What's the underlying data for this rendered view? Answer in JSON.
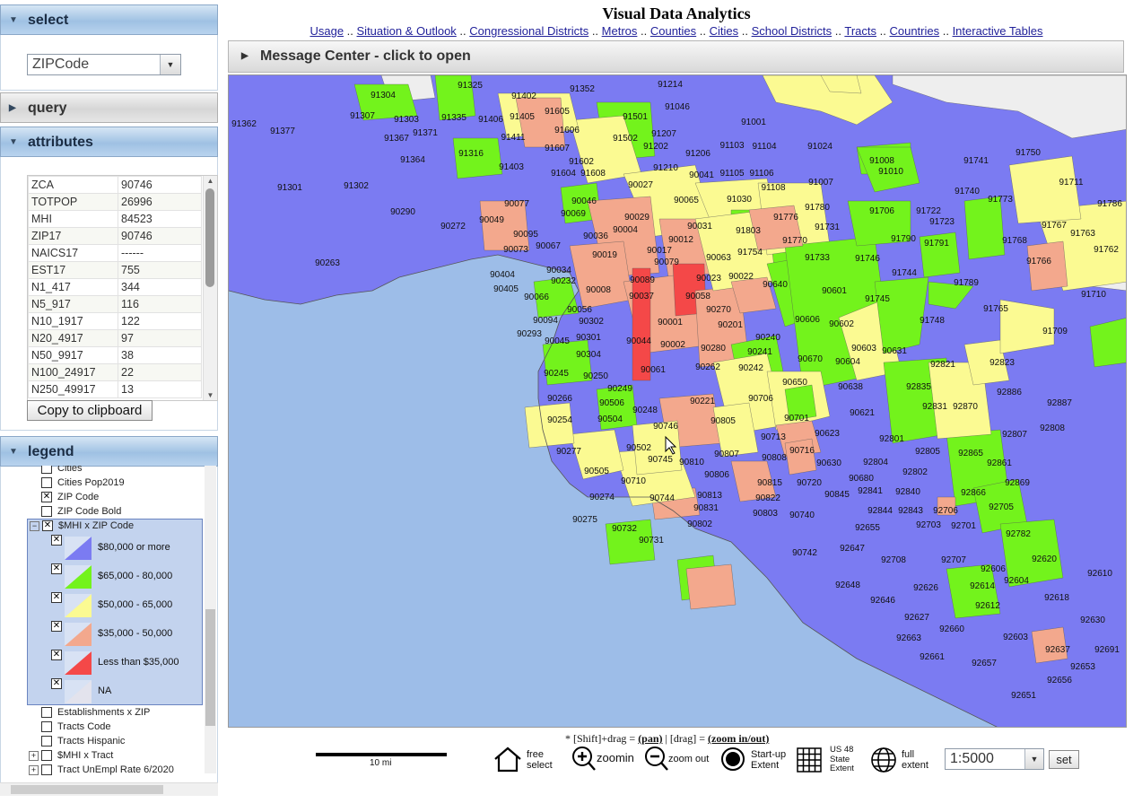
{
  "panels": {
    "select": {
      "title": "select",
      "value": "ZIPCode"
    },
    "query": {
      "title": "query"
    },
    "attributes": {
      "title": "attributes",
      "rows": [
        {
          "key": "ZCA",
          "val": "90746"
        },
        {
          "key": "TOTPOP",
          "val": "26996"
        },
        {
          "key": "MHI",
          "val": "84523"
        },
        {
          "key": "ZIP17",
          "val": "90746"
        },
        {
          "key": "NAICS17",
          "val": "------"
        },
        {
          "key": "EST17",
          "val": "755"
        },
        {
          "key": "N1_417",
          "val": "344"
        },
        {
          "key": "N5_917",
          "val": "116"
        },
        {
          "key": "N10_1917",
          "val": "122"
        },
        {
          "key": "N20_4917",
          "val": "97"
        },
        {
          "key": "N50_9917",
          "val": "38"
        },
        {
          "key": "N100_24917",
          "val": "22"
        },
        {
          "key": "N250_49917",
          "val": "13"
        }
      ],
      "copy_label": "Copy to clipboard"
    },
    "legend": {
      "title": "legend",
      "items_top": [
        {
          "label": "Cities",
          "checked": false
        },
        {
          "label": "Cities Pop2019",
          "checked": false
        },
        {
          "label": "ZIP Code",
          "checked": true
        },
        {
          "label": "ZIP Code Bold",
          "checked": false
        }
      ],
      "group": {
        "label": "$MHI x ZIP Code",
        "classes": [
          {
            "label": "$80,000 or more",
            "color": "#7b7bf2"
          },
          {
            "label": "$65,000 - 80,000",
            "color": "#73f31c"
          },
          {
            "label": "$50,000 - 65,000",
            "color": "#fbfa92"
          },
          {
            "label": "$35,000 - 50,000",
            "color": "#f3a88d"
          },
          {
            "label": "Less than $35,000",
            "color": "#f44848"
          },
          {
            "label": "NA",
            "color": "#e3e3ed"
          }
        ]
      },
      "items_bottom": [
        {
          "label": "Establishments x ZIP",
          "expand": false
        },
        {
          "label": "Tracts Code",
          "expand": false
        },
        {
          "label": "Tracts Hispanic",
          "expand": false
        },
        {
          "label": "$MHI x Tract",
          "expand": true
        },
        {
          "label": "Tract UnEmpl Rate 6/2020",
          "expand": true
        }
      ]
    }
  },
  "header": {
    "title": "Visual Data Analytics",
    "links": [
      "Usage",
      "Situation & Outlook",
      "Congressional Districts",
      "Metros",
      "Counties",
      "Cities",
      "School Districts",
      "Tracts",
      "Countries",
      "Interactive Tables"
    ],
    "separator": ".."
  },
  "message_center": "Message Center - click to open",
  "map": {
    "colors": {
      "ocean": "#9dbde8",
      "c80": "#7b7bf2",
      "c65": "#73f31c",
      "c50": "#fbfa92",
      "c35": "#f3a88d",
      "clt35": "#f44848",
      "na": "#eeeeee"
    },
    "zip_labels": [
      [
        "91304",
        426,
        104
      ],
      [
        "91325",
        523,
        93
      ],
      [
        "91352",
        648,
        97
      ],
      [
        "91214",
        746,
        92
      ],
      [
        "91402",
        583,
        105
      ],
      [
        "91046",
        754,
        117
      ],
      [
        "91362",
        271,
        136
      ],
      [
        "91307",
        403,
        127
      ],
      [
        "91303",
        452,
        131
      ],
      [
        "91335",
        505,
        129
      ],
      [
        "91406",
        546,
        131
      ],
      [
        "91405",
        581,
        128
      ],
      [
        "91605",
        620,
        122
      ],
      [
        "91501",
        707,
        128
      ],
      [
        "91001",
        839,
        134
      ],
      [
        "91377",
        314,
        144
      ],
      [
        "91367",
        441,
        152
      ],
      [
        "91371",
        473,
        146
      ],
      [
        "91411",
        571,
        151
      ],
      [
        "91606",
        631,
        143
      ],
      [
        "91502",
        696,
        152
      ],
      [
        "91207",
        739,
        147
      ],
      [
        "91103",
        815,
        160
      ],
      [
        "91104",
        851,
        161
      ],
      [
        "91024",
        913,
        161
      ],
      [
        "91364",
        459,
        176
      ],
      [
        "91316",
        524,
        169
      ],
      [
        "91607",
        620,
        163
      ],
      [
        "91202",
        730,
        161
      ],
      [
        "91206",
        777,
        169
      ],
      [
        "91750",
        1145,
        168
      ],
      [
        "91602",
        647,
        178
      ],
      [
        "91403",
        569,
        184
      ],
      [
        "91604",
        627,
        191
      ],
      [
        "91608",
        660,
        191
      ],
      [
        "91210",
        741,
        185
      ],
      [
        "90041",
        781,
        193
      ],
      [
        "91105",
        815,
        191
      ],
      [
        "91106",
        848,
        191
      ],
      [
        "91008",
        982,
        177
      ],
      [
        "91010",
        992,
        189
      ],
      [
        "91741",
        1087,
        177
      ],
      [
        "91301",
        322,
        207
      ],
      [
        "91302",
        396,
        205
      ],
      [
        "90027",
        713,
        204
      ],
      [
        "91108",
        861,
        207
      ],
      [
        "91007",
        914,
        201
      ],
      [
        "91711",
        1193,
        201
      ],
      [
        "91740",
        1077,
        211
      ],
      [
        "91773",
        1114,
        220
      ],
      [
        "90077",
        575,
        225
      ],
      [
        "90046",
        650,
        222
      ],
      [
        "90065",
        764,
        221
      ],
      [
        "91030",
        823,
        220
      ],
      [
        "91780",
        910,
        229
      ],
      [
        "91706",
        982,
        233
      ],
      [
        "91722",
        1034,
        233
      ],
      [
        "91786",
        1236,
        225
      ],
      [
        "90290",
        448,
        234
      ],
      [
        "90049",
        547,
        243
      ],
      [
        "90069",
        638,
        236
      ],
      [
        "90029",
        709,
        240
      ],
      [
        "91776",
        875,
        240
      ],
      [
        "91723",
        1049,
        245
      ],
      [
        "91767",
        1174,
        249
      ],
      [
        "90272",
        504,
        250
      ],
      [
        "90004",
        696,
        254
      ],
      [
        "90031",
        779,
        250
      ],
      [
        "91803",
        833,
        255
      ],
      [
        "91731",
        921,
        251
      ],
      [
        "91790",
        1006,
        264
      ],
      [
        "91763",
        1206,
        258
      ],
      [
        "90095",
        585,
        259
      ],
      [
        "90036",
        663,
        261
      ],
      [
        "90012",
        758,
        265
      ],
      [
        "91770",
        885,
        266
      ],
      [
        "91791",
        1043,
        269
      ],
      [
        "91768",
        1130,
        266
      ],
      [
        "91762",
        1232,
        276
      ],
      [
        "90073",
        574,
        276
      ],
      [
        "90067",
        610,
        272
      ],
      [
        "90017",
        734,
        277
      ],
      [
        "91754",
        835,
        279
      ],
      [
        "91733",
        910,
        285
      ],
      [
        "91766",
        1157,
        289
      ],
      [
        "90263",
        364,
        291
      ],
      [
        "90019",
        673,
        282
      ],
      [
        "90079",
        742,
        290
      ],
      [
        "90063",
        800,
        285
      ],
      [
        "90022",
        825,
        306
      ],
      [
        "91746",
        966,
        286
      ],
      [
        "91744",
        1007,
        302
      ],
      [
        "90034",
        622,
        299
      ],
      [
        "90404",
        559,
        304
      ],
      [
        "90232",
        627,
        311
      ],
      [
        "90023",
        789,
        308
      ],
      [
        "90640",
        863,
        315
      ],
      [
        "91789",
        1076,
        313
      ],
      [
        "91710",
        1218,
        326
      ],
      [
        "90405",
        563,
        320
      ],
      [
        "90008",
        666,
        321
      ],
      [
        "90089",
        715,
        310
      ],
      [
        "90601",
        929,
        322
      ],
      [
        "91745",
        977,
        331
      ],
      [
        "90066",
        597,
        329
      ],
      [
        "90037",
        714,
        328
      ],
      [
        "90058",
        777,
        328
      ],
      [
        "90270",
        800,
        343
      ],
      [
        "91765",
        1109,
        342
      ],
      [
        "90056",
        645,
        343
      ],
      [
        "90302",
        658,
        356
      ],
      [
        "90201",
        813,
        360
      ],
      [
        "90606",
        899,
        354
      ],
      [
        "90602",
        937,
        359
      ],
      [
        "91748",
        1038,
        355
      ],
      [
        "91709",
        1175,
        367
      ],
      [
        "90094",
        607,
        355
      ],
      [
        "90001",
        746,
        357
      ],
      [
        "90240",
        855,
        374
      ],
      [
        "90293",
        589,
        370
      ],
      [
        "90045",
        620,
        378
      ],
      [
        "90301",
        655,
        374
      ],
      [
        "90044",
        711,
        378
      ],
      [
        "90002",
        749,
        382
      ],
      [
        "90280",
        794,
        386
      ],
      [
        "90603",
        962,
        386
      ],
      [
        "90631",
        996,
        389
      ],
      [
        "90304",
        655,
        393
      ],
      [
        "90241",
        846,
        390
      ],
      [
        "90670",
        902,
        398
      ],
      [
        "90604",
        944,
        401
      ],
      [
        "92821",
        1050,
        404
      ],
      [
        "92823",
        1116,
        402
      ],
      [
        "90245",
        619,
        414
      ],
      [
        "90250",
        663,
        417
      ],
      [
        "90061",
        727,
        410
      ],
      [
        "90262",
        788,
        407
      ],
      [
        "90242",
        836,
        408
      ],
      [
        "90249",
        690,
        431
      ],
      [
        "90650",
        885,
        424
      ],
      [
        "90638",
        947,
        429
      ],
      [
        "92835",
        1023,
        429
      ],
      [
        "92886",
        1124,
        435
      ],
      [
        "92887",
        1180,
        447
      ],
      [
        "90266",
        623,
        442
      ],
      [
        "90506",
        681,
        447
      ],
      [
        "90221",
        782,
        445
      ],
      [
        "90706",
        847,
        442
      ],
      [
        "92831",
        1041,
        451
      ],
      [
        "92870",
        1075,
        451
      ],
      [
        "90248",
        718,
        455
      ],
      [
        "90621",
        960,
        458
      ],
      [
        "90254",
        623,
        466
      ],
      [
        "90504",
        679,
        465
      ],
      [
        "90746",
        741,
        473
      ],
      [
        "90805",
        805,
        467
      ],
      [
        "90701",
        887,
        464
      ],
      [
        "92808",
        1172,
        475
      ],
      [
        "90713",
        861,
        485
      ],
      [
        "90623",
        921,
        481
      ],
      [
        "92801",
        993,
        487
      ],
      [
        "92807",
        1130,
        482
      ],
      [
        "90277",
        633,
        501
      ],
      [
        "90502",
        711,
        497
      ],
      [
        "90716",
        893,
        500
      ],
      [
        "92805",
        1033,
        501
      ],
      [
        "92865",
        1081,
        503
      ],
      [
        "90745",
        735,
        510
      ],
      [
        "90810",
        770,
        513
      ],
      [
        "90807",
        809,
        504
      ],
      [
        "90808",
        862,
        508
      ],
      [
        "90630",
        923,
        514
      ],
      [
        "92804",
        975,
        513
      ],
      [
        "92861",
        1113,
        514
      ],
      [
        "90505",
        664,
        523
      ],
      [
        "90806",
        798,
        527
      ],
      [
        "92802",
        1019,
        524
      ],
      [
        "92869",
        1133,
        536
      ],
      [
        "90710",
        705,
        534
      ],
      [
        "90815",
        857,
        536
      ],
      [
        "90720",
        901,
        536
      ],
      [
        "90680",
        959,
        531
      ],
      [
        "90274",
        670,
        552
      ],
      [
        "90744",
        737,
        553
      ],
      [
        "90813",
        790,
        550
      ],
      [
        "90822",
        855,
        553
      ],
      [
        "90845",
        932,
        549
      ],
      [
        "92841",
        969,
        545
      ],
      [
        "92840",
        1011,
        546
      ],
      [
        "92866",
        1084,
        547
      ],
      [
        "90831",
        786,
        564
      ],
      [
        "90803",
        852,
        570
      ],
      [
        "92844",
        980,
        567
      ],
      [
        "92843",
        1014,
        567
      ],
      [
        "92706",
        1053,
        567
      ],
      [
        "92705",
        1115,
        563
      ],
      [
        "90275",
        651,
        577
      ],
      [
        "90802",
        779,
        582
      ],
      [
        "90740",
        893,
        572
      ],
      [
        "92655",
        966,
        586
      ],
      [
        "92703",
        1034,
        583
      ],
      [
        "92701",
        1073,
        584
      ],
      [
        "92782",
        1134,
        593
      ],
      [
        "90732",
        695,
        587
      ],
      [
        "90731",
        725,
        600
      ],
      [
        "92647",
        949,
        609
      ],
      [
        "90742",
        896,
        614
      ],
      [
        "92708",
        995,
        622
      ],
      [
        "92707",
        1062,
        622
      ],
      [
        "92620",
        1163,
        621
      ],
      [
        "92606",
        1106,
        632
      ],
      [
        "92604",
        1132,
        645
      ],
      [
        "92610",
        1225,
        637
      ],
      [
        "92648",
        944,
        650
      ],
      [
        "92626",
        1031,
        653
      ],
      [
        "92614",
        1094,
        651
      ],
      [
        "92646",
        983,
        667
      ],
      [
        "92618",
        1177,
        664
      ],
      [
        "92612",
        1100,
        673
      ],
      [
        "92627",
        1021,
        686
      ],
      [
        "92630",
        1217,
        689
      ],
      [
        "92660",
        1060,
        699
      ],
      [
        "92663",
        1012,
        709
      ],
      [
        "92603",
        1131,
        708
      ],
      [
        "92637",
        1178,
        722
      ],
      [
        "92691",
        1233,
        722
      ],
      [
        "92661",
        1038,
        730
      ],
      [
        "92657",
        1096,
        737
      ],
      [
        "92653",
        1206,
        741
      ],
      [
        "92656",
        1180,
        756
      ],
      [
        "92651",
        1140,
        773
      ]
    ]
  },
  "bottom": {
    "hint_prefix": "* [Shift]+drag = ",
    "hint_pan": "(pan)",
    "hint_sep": " | [drag] = ",
    "hint_zoom": "(zoom in/out)",
    "scale_label": "10 mi",
    "tools": {
      "free_select": "free\nselect",
      "zoomin": "zoomin",
      "zoomout": "zoom out",
      "startup": "Start-up\nExtent",
      "us48": "US 48\nState\nExtent",
      "full": "full\nextent"
    },
    "zoom_value": "1:5000",
    "set_label": "set"
  }
}
